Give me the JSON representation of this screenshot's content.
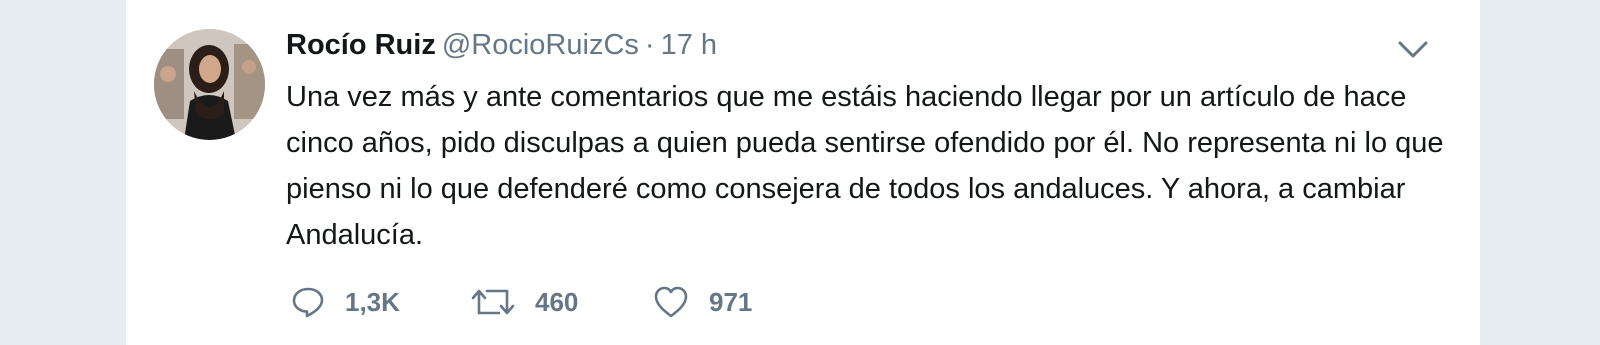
{
  "tweet": {
    "author_name": "Rocío Ruiz",
    "handle": "@RocioRuizCs",
    "separator": "·",
    "time": "17 h",
    "text": "Una vez más y ante comentarios que me estáis haciendo llegar por un artículo de hace cinco años, pido disculpas a quien pueda sentirse ofendido por él. No representa ni lo que pienso ni lo que defenderé como consejera de todos los andaluces. Y ahora, a cambiar Andalucía."
  },
  "actions": {
    "reply_icon": "reply-icon",
    "reply_count": "1,3K",
    "retweet_icon": "retweet-icon",
    "retweet_count": "460",
    "like_icon": "heart-icon",
    "like_count": "971"
  },
  "menu_icon": "chevron-down-icon",
  "colors": {
    "page_bg": "#e6ecf0",
    "card_bg": "#ffffff",
    "text": "#14171a",
    "muted": "#657786"
  }
}
